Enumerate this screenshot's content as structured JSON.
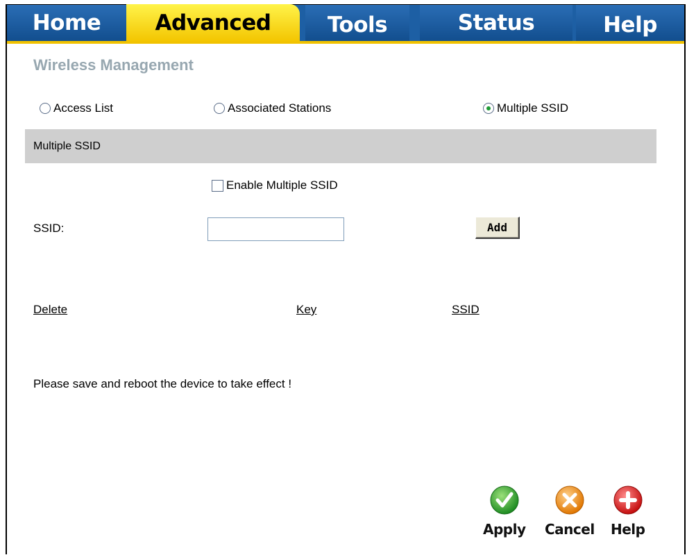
{
  "nav": {
    "tabs": [
      "Home",
      "Advanced",
      "Tools",
      "Status",
      "Help"
    ],
    "active": "Advanced",
    "accent": "#f3c500",
    "tab_color": "#1d5fa4"
  },
  "page": {
    "title": "Wireless Management"
  },
  "mode_options": {
    "access_list": "Access List",
    "associated_stations": "Associated Stations",
    "multiple_ssid": "Multiple SSID",
    "selected": "Multiple SSID"
  },
  "section": {
    "title": "Multiple SSID"
  },
  "form": {
    "enable_label": "Enable Multiple SSID",
    "enable_checked": false,
    "ssid_label": "SSID:",
    "ssid_value": "",
    "add_label": "Add"
  },
  "table": {
    "columns": [
      "Delete",
      "Key",
      "SSID"
    ]
  },
  "note": "Please save and reboot the device to take effect !",
  "actions": {
    "apply": "Apply",
    "cancel": "Cancel",
    "help": "Help"
  },
  "icons": {
    "apply": "check-icon",
    "cancel": "x-icon",
    "help": "plus-icon"
  }
}
